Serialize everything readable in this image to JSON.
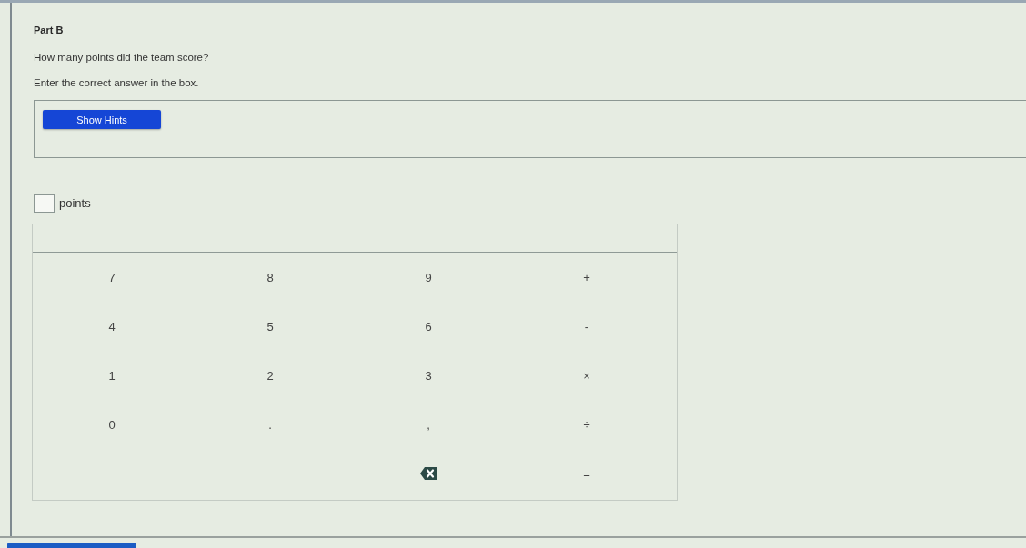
{
  "part": {
    "title": "Part B"
  },
  "question": "How many points did the team score?",
  "instruction": "Enter the correct answer in the box.",
  "hints": {
    "button": "Show Hints"
  },
  "answer": {
    "unit": "points"
  },
  "keypad": {
    "rows": [
      [
        {
          "kind": "key",
          "label": "7"
        },
        {
          "kind": "key",
          "label": "8"
        },
        {
          "kind": "key",
          "label": "9"
        },
        {
          "kind": "key",
          "label": "+"
        }
      ],
      [
        {
          "kind": "key",
          "label": "4"
        },
        {
          "kind": "key",
          "label": "5"
        },
        {
          "kind": "key",
          "label": "6"
        },
        {
          "kind": "key",
          "label": "-"
        }
      ],
      [
        {
          "kind": "key",
          "label": "1"
        },
        {
          "kind": "key",
          "label": "2"
        },
        {
          "kind": "key",
          "label": "3"
        },
        {
          "kind": "key",
          "label": "×"
        }
      ],
      [
        {
          "kind": "key",
          "label": "0"
        },
        {
          "kind": "key",
          "label": "."
        },
        {
          "kind": "key",
          "label": ","
        },
        {
          "kind": "key",
          "label": "÷"
        }
      ],
      [
        "",
        "",
        {
          "kind": "backspace"
        },
        {
          "kind": "key",
          "label": "="
        }
      ]
    ]
  }
}
